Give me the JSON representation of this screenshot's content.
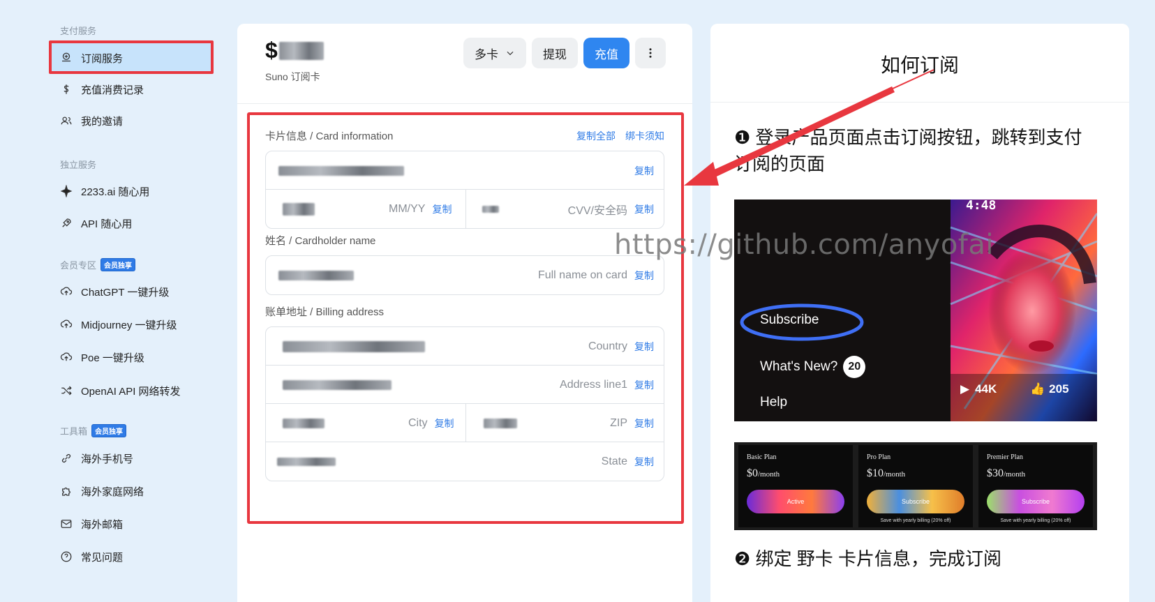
{
  "sidebar": {
    "sections": [
      {
        "title": "支付服务"
      },
      {
        "title": "独立服务"
      },
      {
        "title": "会员专区",
        "badge": "会员独享"
      },
      {
        "title": "工具箱",
        "badge": "会员独享"
      }
    ],
    "items": [
      {
        "label": "订阅服务",
        "icon": "subscription-icon"
      },
      {
        "label": "充值消费记录",
        "icon": "dollar-icon"
      },
      {
        "label": "我的邀请",
        "icon": "users-icon"
      },
      {
        "label": "2233.ai 随心用",
        "icon": "sparkle-icon"
      },
      {
        "label": "API 随心用",
        "icon": "rocket-icon"
      },
      {
        "label": "ChatGPT 一键升级",
        "icon": "upgrade-icon"
      },
      {
        "label": "Midjourney 一键升级",
        "icon": "upgrade-icon"
      },
      {
        "label": "Poe 一键升级",
        "icon": "upgrade-icon"
      },
      {
        "label": "OpenAI API 网络转发",
        "icon": "shuffle-icon"
      },
      {
        "label": "海外手机号",
        "icon": "phone-link-icon"
      },
      {
        "label": "海外家庭网络",
        "icon": "puzzle-icon"
      },
      {
        "label": "海外邮箱",
        "icon": "mail-icon"
      },
      {
        "label": "常见问题",
        "icon": "help-icon"
      }
    ]
  },
  "card": {
    "balance_prefix": "$",
    "subtitle": "Suno 订阅卡",
    "buttons": {
      "multi": "多卡",
      "withdraw": "提现",
      "recharge": "充值"
    },
    "card_info": {
      "label": "卡片信息 / Card information",
      "copy_all": "复制全部",
      "binding_notice": "绑卡须知",
      "expiry_hint": "MM/YY",
      "cvv_hint": "CVV/安全码"
    },
    "name": {
      "label": "姓名 / Cardholder name",
      "hint": "Full name on card"
    },
    "billing": {
      "label": "账单地址 / Billing address",
      "country": "Country",
      "address": "Address line1",
      "city": "City",
      "zip": "ZIP",
      "state": "State"
    },
    "copy": "复制"
  },
  "guide": {
    "title": "如何订阅",
    "step1": "❶ 登录产品页面点击订阅按钮，跳转到支付订阅的页面",
    "step2": "❷ 绑定 野卡 卡片信息，完成订阅",
    "shot1": {
      "time": "4:48",
      "subscribe": "Subscribe",
      "whats_new": "What's New?",
      "new_count": "20",
      "help": "Help",
      "plays": "44K",
      "likes": "205"
    },
    "plans": [
      {
        "name": "Basic Plan",
        "price": "$0",
        "per": "/month",
        "button": "Active",
        "note": ""
      },
      {
        "name": "Pro Plan",
        "price": "$10",
        "per": "/month",
        "button": "Subscribe",
        "note": "Save with yearly billing (20% off)"
      },
      {
        "name": "Premier Plan",
        "price": "$30",
        "per": "/month",
        "button": "Subscribe",
        "note": "Save with yearly billing (20% off)"
      }
    ]
  },
  "watermark": "https://github.com/anyofai",
  "colors": {
    "accent": "#2f86f0",
    "highlight": "#e8373f",
    "background": "#e4f0fb"
  }
}
